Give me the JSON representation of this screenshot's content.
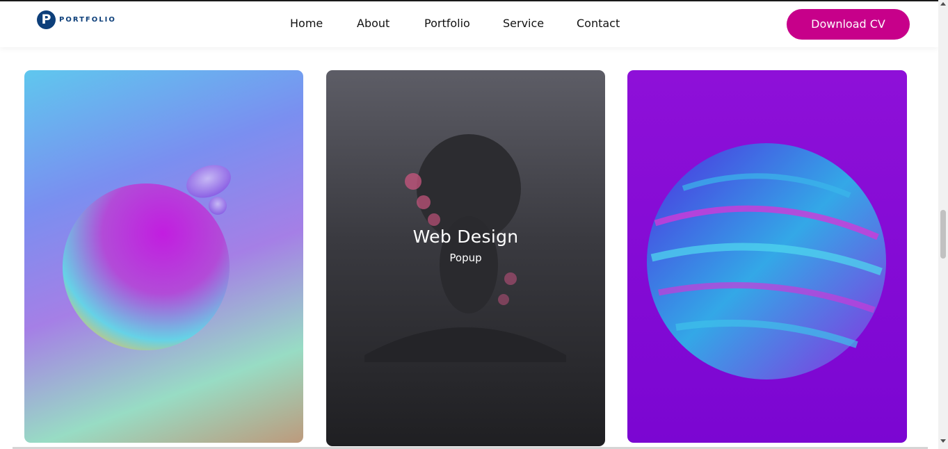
{
  "header": {
    "logo_mark": "P",
    "logo_text": "PORTFOLIO",
    "nav": [
      "Home",
      "About",
      "Portfolio",
      "Service",
      "Contact"
    ],
    "cta_label": "Download CV"
  },
  "colors": {
    "accent": "#c7008a",
    "logo": "#0d3f7a"
  },
  "gallery": {
    "hover_card": {
      "title": "Web Design",
      "subtitle": "Popup"
    }
  }
}
